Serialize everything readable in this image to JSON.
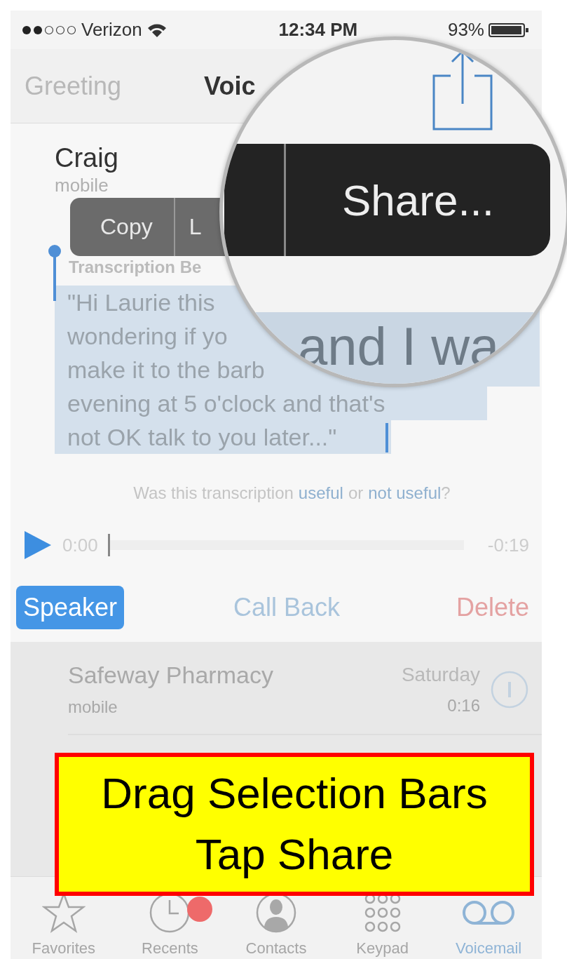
{
  "status_bar": {
    "carrier": "Verizon",
    "time": "12:34 PM",
    "battery": "93%"
  },
  "nav_bar": {
    "left_button": "Greeting",
    "title": "Voic"
  },
  "voicemail": {
    "caller": "Craig",
    "caller_label": "mobile",
    "transcription_heading": "Transcription Be",
    "transcript_lines": [
      "\"Hi Laurie this",
      "wondering if yo",
      "make it to the barb",
      "evening at 5 o'clock and that's",
      "not OK talk to you later...\""
    ],
    "feedback": {
      "prefix": "Was this transcription",
      "link_1": "useful",
      "middle": "or",
      "link_2": "not useful",
      "suffix": "?"
    }
  },
  "edit_menu": {
    "items": [
      "Copy",
      "L"
    ]
  },
  "magnifier": {
    "menu_item": "Share...",
    "text": "and I wa"
  },
  "player": {
    "elapsed": "0:00",
    "remaining": "-0:19",
    "level": 0
  },
  "actions": [
    {
      "label": "Speaker",
      "kind": "toggle",
      "selected": true
    },
    {
      "label": "Call Back",
      "kind": "call",
      "selected": false
    },
    {
      "label": "Delete",
      "kind": "destructive",
      "selected": false
    }
  ],
  "list": [
    {
      "name": "Safeway Pharmacy",
      "label": "mobile",
      "date": "Saturday",
      "duration": "0:16"
    }
  ],
  "tab_bar": [
    {
      "label": "Favorites",
      "kind": "favorites",
      "selected": false,
      "badge": false
    },
    {
      "label": "Recents",
      "kind": "recents",
      "selected": false,
      "badge": true
    },
    {
      "label": "Contacts",
      "kind": "contacts",
      "selected": false,
      "badge": false
    },
    {
      "label": "Keypad",
      "kind": "keypad",
      "selected": false,
      "badge": false
    },
    {
      "label": "Voicemail",
      "kind": "voicemail",
      "selected": true,
      "badge": false
    }
  ],
  "callout": {
    "lines": [
      "Drag Selection Bars",
      "Tap Share"
    ]
  }
}
